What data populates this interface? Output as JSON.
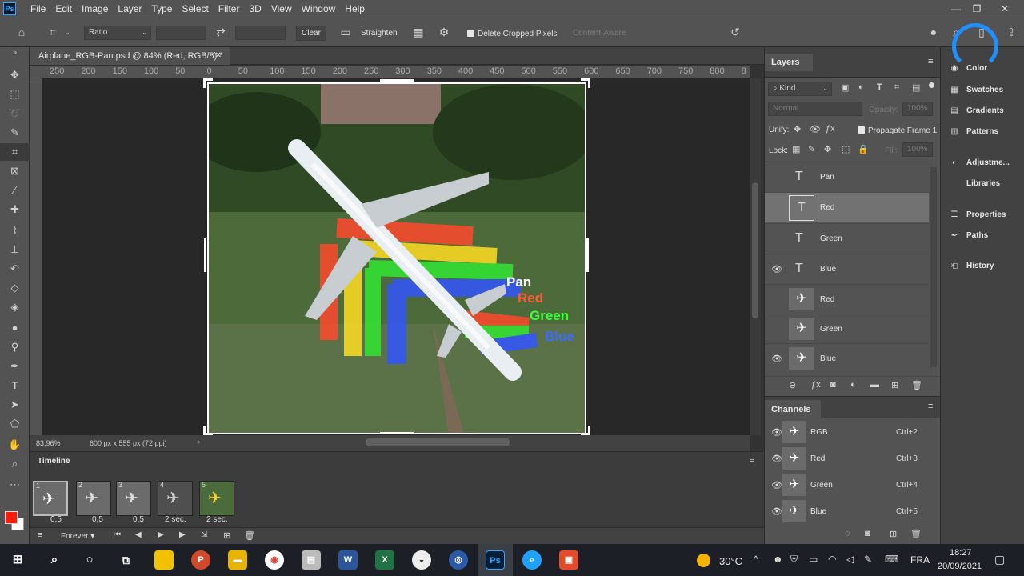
{
  "menu": {
    "app_icon": "Ps",
    "items": [
      "File",
      "Edit",
      "Image",
      "Layer",
      "Type",
      "Select",
      "Filter",
      "3D",
      "View",
      "Window",
      "Help"
    ]
  },
  "options": {
    "ratio": "Ratio",
    "clear": "Clear",
    "straighten": "Straighten",
    "delete_cropped": "Delete Cropped Pixels",
    "content_aware": "Content-Aware"
  },
  "document": {
    "tab_title": "Airplane_RGB-Pan.psd @ 84% (Red, RGB/8) *",
    "zoom": "83,96%",
    "doc_size": "600 px x 555 px (72 ppi)",
    "ruler_labels": [
      "250",
      "200",
      "150",
      "100",
      "50",
      "0",
      "50",
      "100",
      "150",
      "200",
      "250",
      "300",
      "350",
      "400",
      "450",
      "500",
      "550",
      "600",
      "650",
      "700",
      "750",
      "800",
      "8"
    ]
  },
  "image_labels": {
    "pan": "Pan",
    "red": "Red",
    "green": "Green",
    "blue": "Blue",
    "colors": {
      "pan": "#ffffff",
      "red": "#ff5a3c",
      "green": "#3cff3c",
      "blue": "#3c6bff"
    }
  },
  "timeline": {
    "title": "Timeline",
    "frames": [
      {
        "num": "1",
        "delay": "0,5"
      },
      {
        "num": "2",
        "delay": "0,5"
      },
      {
        "num": "3",
        "delay": "0,5"
      },
      {
        "num": "4",
        "delay": "2 sec."
      },
      {
        "num": "5",
        "delay": "2 sec."
      }
    ],
    "loop": "Forever"
  },
  "layers": {
    "tab": "Layers",
    "filter_kind": "Kind",
    "blend_mode": "Normal",
    "opacity_label": "Opacity:",
    "opacity_value": "100%",
    "unify_label": "Unify:",
    "propagate": "Propagate Frame 1",
    "lock_label": "Lock:",
    "fill_label": "Fill:",
    "fill_value": "100%",
    "items": [
      {
        "name": "Pan",
        "type": "text",
        "visible": false
      },
      {
        "name": "Red",
        "type": "text",
        "visible": false
      },
      {
        "name": "Green",
        "type": "text",
        "visible": false
      },
      {
        "name": "Blue",
        "type": "text",
        "visible": true
      },
      {
        "name": "Red",
        "type": "image",
        "visible": false
      },
      {
        "name": "Green",
        "type": "image",
        "visible": false
      },
      {
        "name": "Blue",
        "type": "image",
        "visible": true
      }
    ]
  },
  "channels": {
    "tab": "Channels",
    "items": [
      {
        "name": "RGB",
        "shortcut": "Ctrl+2"
      },
      {
        "name": "Red",
        "shortcut": "Ctrl+3"
      },
      {
        "name": "Green",
        "shortcut": "Ctrl+4"
      },
      {
        "name": "Blue",
        "shortcut": "Ctrl+5"
      }
    ]
  },
  "right_panels": {
    "items": [
      "Color",
      "Swatches",
      "Gradients",
      "Patterns",
      "Adjustme...",
      "Libraries",
      "Properties",
      "Paths",
      "History"
    ]
  },
  "taskbar": {
    "temperature": "30°C",
    "language": "FRA",
    "time": "18:27",
    "date": "20/09/2021"
  }
}
